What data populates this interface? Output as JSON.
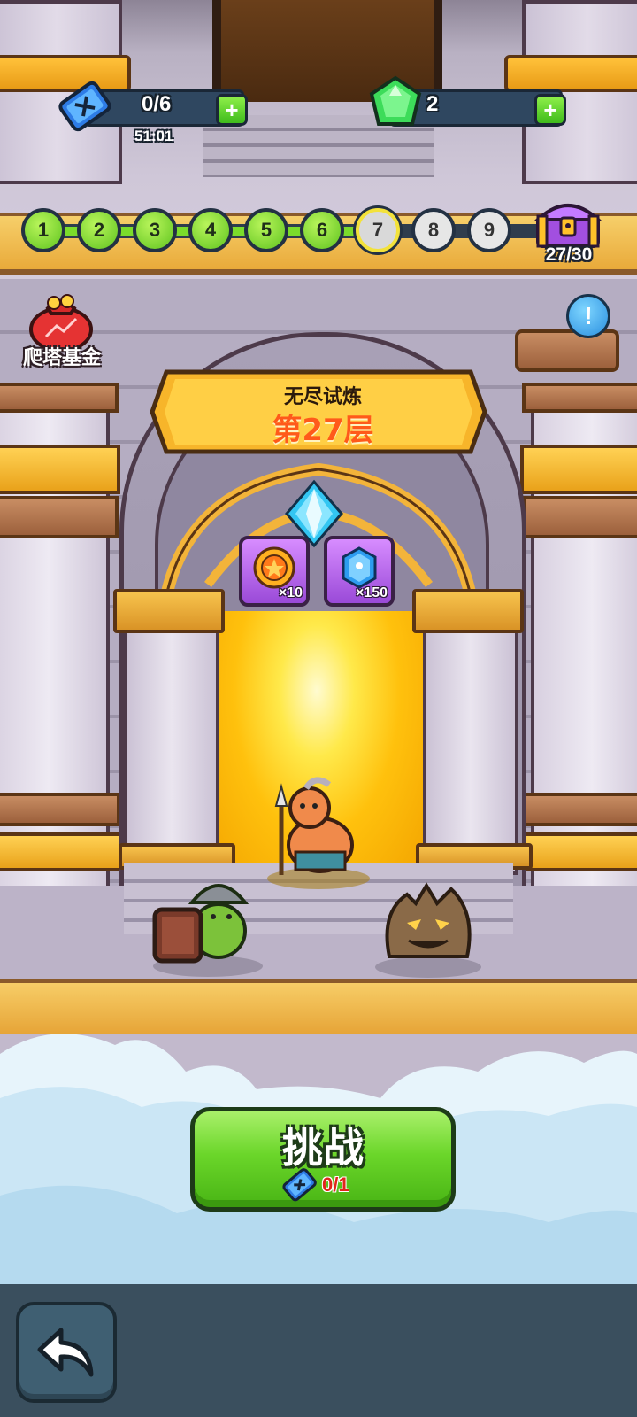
{
  "resources": {
    "tickets": "0/6",
    "ticket_timer": "51:01",
    "gems": "2"
  },
  "floor_progress": {
    "nodes": [
      "1",
      "2",
      "3",
      "4",
      "5",
      "6",
      "7",
      "8",
      "9"
    ],
    "completed_through": 6,
    "current": 7,
    "chest_count": "27/30"
  },
  "fund": {
    "label": "爬塔基金"
  },
  "info": {
    "symbol": "!"
  },
  "stage": {
    "subtitle": "无尽试炼",
    "title": "第27层"
  },
  "rewards": [
    {
      "icon": "gold-coin-icon",
      "count": "×10"
    },
    {
      "icon": "blue-crystal-icon",
      "count": "×150"
    }
  ],
  "challenge": {
    "label": "挑战",
    "cost": "0/1"
  },
  "colors": {
    "accent_green": "#6bd62a",
    "banner_orange": "#ffc12a",
    "title_red": "#ff5a1a",
    "bar_navy": "#2f4760"
  }
}
